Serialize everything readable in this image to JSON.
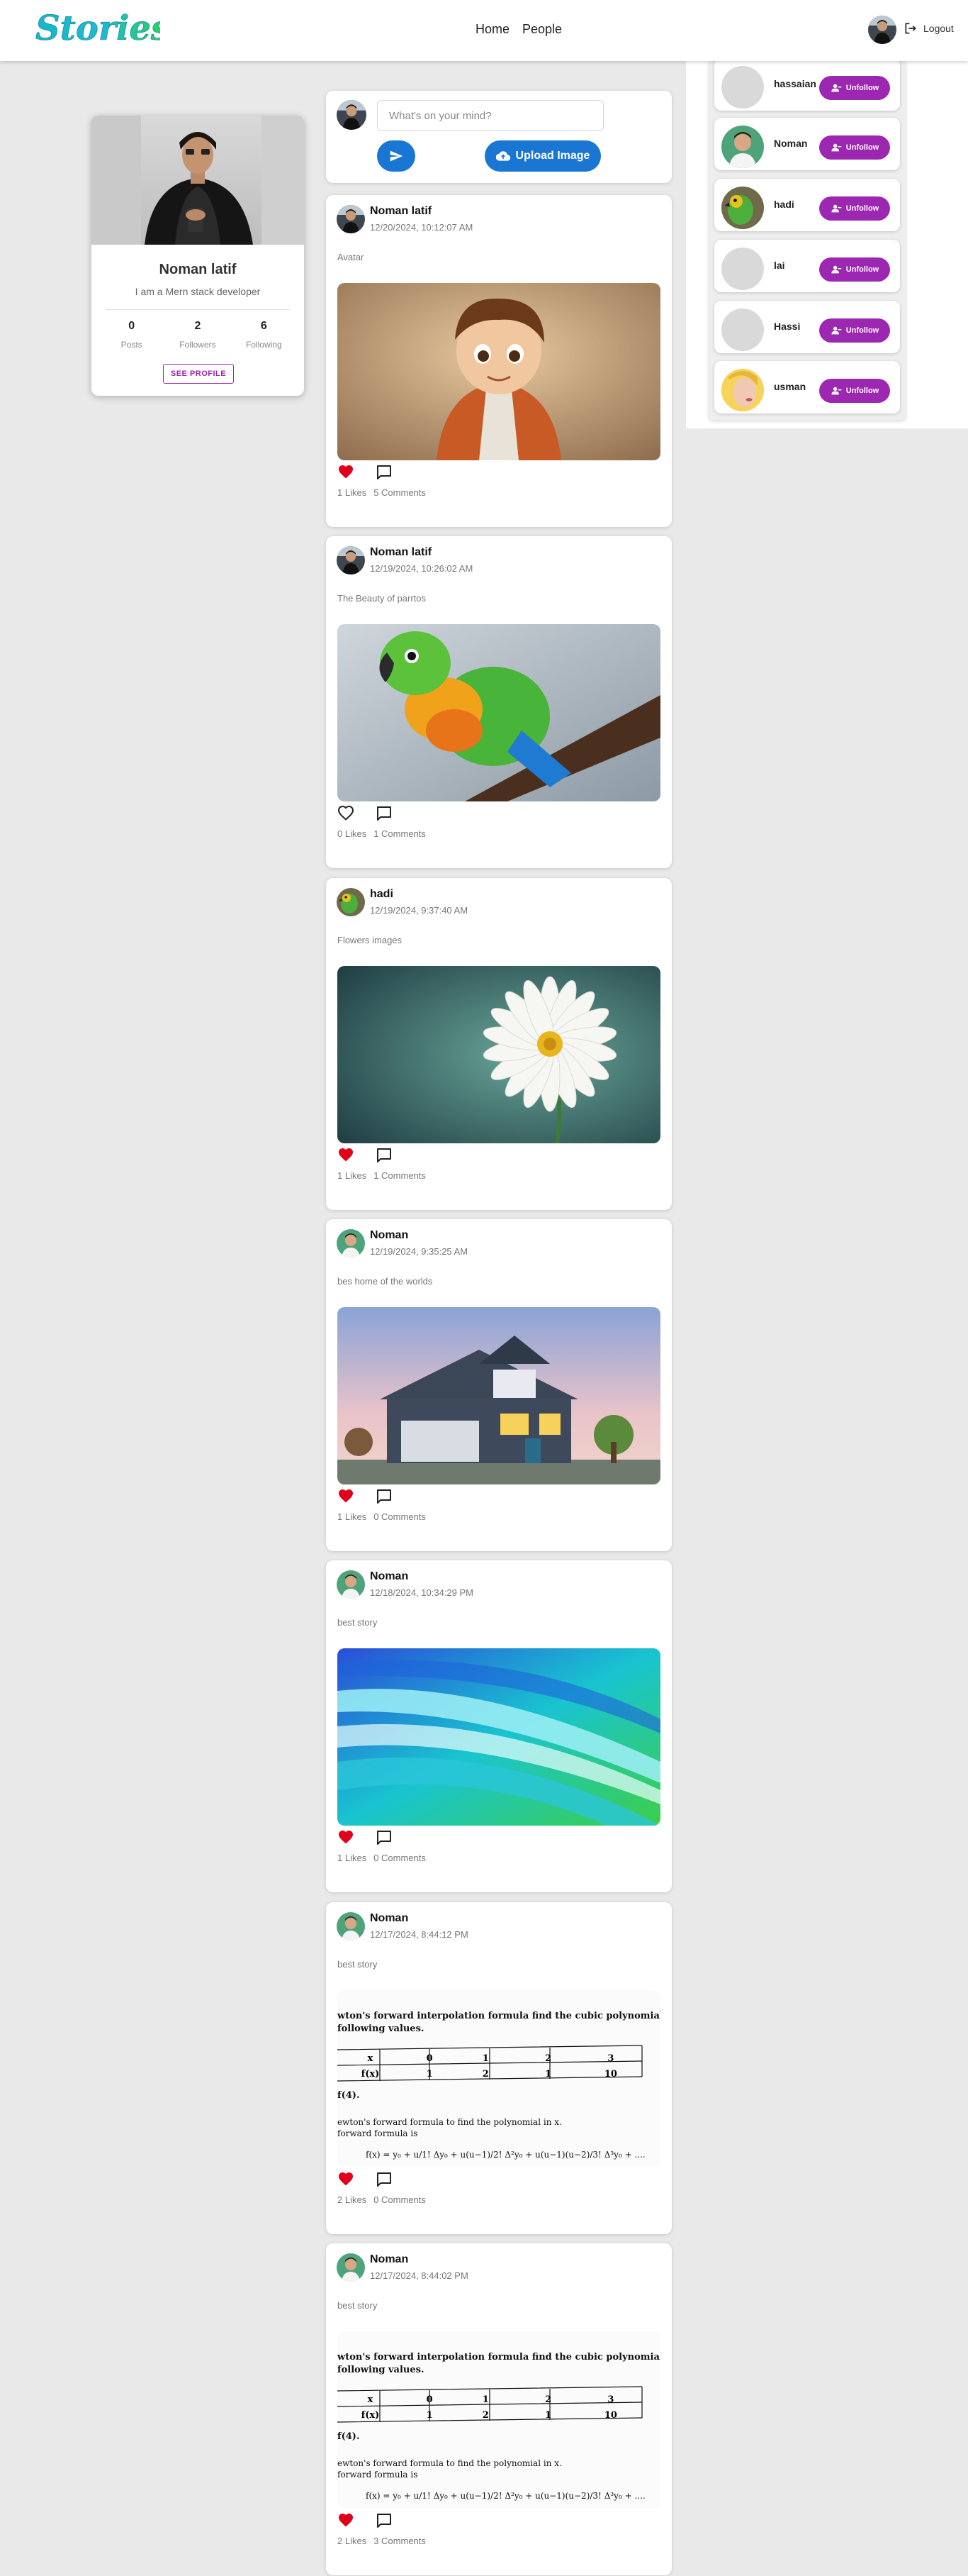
{
  "header": {
    "logo_text": "Stories",
    "nav": [
      "Home",
      "People"
    ],
    "logout_label": "Logout"
  },
  "profile": {
    "name": "Noman latif",
    "bio": "I am a Mern stack developer",
    "stats": [
      {
        "value": "0",
        "label": "Posts"
      },
      {
        "value": "2",
        "label": "Followers"
      },
      {
        "value": "6",
        "label": "Following"
      }
    ],
    "see_profile_label": "SEE PROFILE"
  },
  "composer": {
    "placeholder": "What's on your mind?",
    "upload_label": "Upload Image"
  },
  "posts": [
    {
      "author": "Noman latif",
      "date": "12/20/2024, 10:12:07 AM",
      "caption": "Avatar",
      "likes": "1 Likes",
      "comments": "5 Comments",
      "liked": true,
      "image": "avatar-boy"
    },
    {
      "author": "Noman latif",
      "date": "12/19/2024, 10:26:02 AM",
      "caption": "The Beauty of parrtos",
      "likes": "0 Likes",
      "comments": "1 Comments",
      "liked": false,
      "image": "parrot"
    },
    {
      "author": "hadi",
      "date": "12/19/2024, 9:37:40 AM",
      "caption": "Flowers images",
      "likes": "1 Likes",
      "comments": "1 Comments",
      "liked": true,
      "image": "daisy"
    },
    {
      "author": "Noman",
      "date": "12/19/2024, 9:35:25 AM",
      "caption": "bes home of the worlds",
      "likes": "1 Likes",
      "comments": "0 Comments",
      "liked": true,
      "image": "house"
    },
    {
      "author": "Noman",
      "date": "12/18/2024, 10:34:29 PM",
      "caption": "best story",
      "likes": "1 Likes",
      "comments": "0 Comments",
      "liked": true,
      "image": "gradient-waves"
    },
    {
      "author": "Noman",
      "date": "12/17/2024, 8:44:12 PM",
      "caption": "best story",
      "likes": "2 Likes",
      "comments": "0 Comments",
      "liked": true,
      "image": "math-notes"
    },
    {
      "author": "Noman",
      "date": "12/17/2024, 8:44:02 PM",
      "caption": "best story",
      "likes": "2 Likes",
      "comments": "3 Comments",
      "liked": true,
      "image": "math-notes"
    }
  ],
  "math_notes": {
    "title_line1": "wton's forward interpolation formula find the cubic polynomial",
    "title_line2": "following values.",
    "table_x": [
      "x",
      "0",
      "1",
      "2",
      "3"
    ],
    "table_f": [
      "f(x)",
      "1",
      "2",
      "1",
      "10"
    ],
    "find": "f(4).",
    "body_line1": "ewton's forward formula to find the polynomial in x.",
    "body_line2": "forward formula is",
    "formula": "f(x) = y₀ + u/1! Δy₀ + u(u−1)/2! Δ²y₀ + u(u−1)(u−2)/3! Δ³y₀ + ...."
  },
  "following": [
    {
      "name": "hassaian",
      "unfollow_label": "Unfollow",
      "avatar": "placeholder"
    },
    {
      "name": "Noman",
      "unfollow_label": "Unfollow",
      "avatar": "man-green"
    },
    {
      "name": "hadi",
      "unfollow_label": "Unfollow",
      "avatar": "parrot"
    },
    {
      "name": "lai",
      "unfollow_label": "Unfollow",
      "avatar": "placeholder"
    },
    {
      "name": "Hassi",
      "unfollow_label": "Unfollow",
      "avatar": "placeholder"
    },
    {
      "name": "usman",
      "unfollow_label": "Unfollow",
      "avatar": "woman"
    }
  ],
  "colors": {
    "primary_blue": "#1976d2",
    "purple": "#9c27b0",
    "like_red": "#e0001b",
    "page_bg": "#e9e9e9"
  }
}
